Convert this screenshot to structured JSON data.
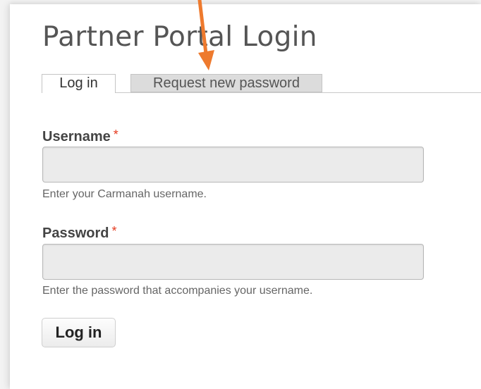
{
  "page": {
    "title": "Partner Portal Login"
  },
  "tabs": [
    {
      "label": "Log in",
      "active": true
    },
    {
      "label": "Request new password",
      "active": false
    }
  ],
  "form": {
    "username": {
      "label": "Username",
      "required_marker": "*",
      "value": "",
      "description": "Enter your Carmanah username."
    },
    "password": {
      "label": "Password",
      "required_marker": "*",
      "value": "",
      "description": "Enter the password that accompanies your username."
    },
    "submit_label": "Log in"
  },
  "annotation": {
    "arrow_color": "#ee7a2e",
    "arrow_icon": "arrow-down-icon"
  }
}
